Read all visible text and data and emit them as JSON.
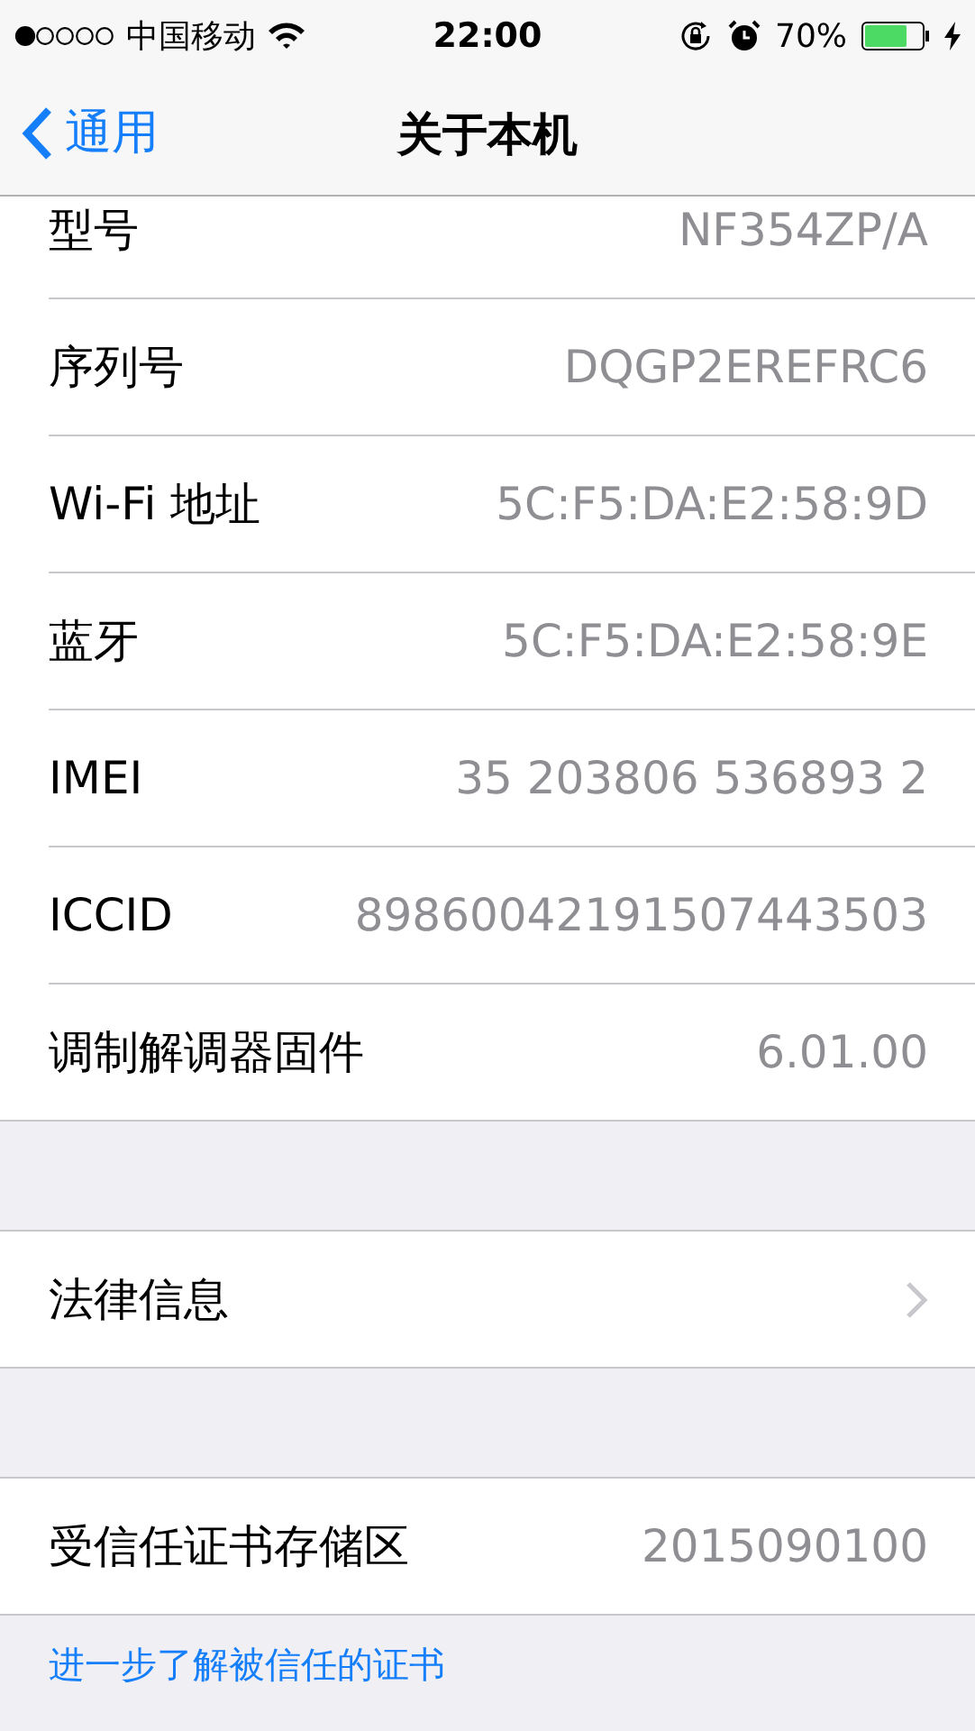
{
  "status_bar": {
    "carrier": "中国移动",
    "time": "22:00",
    "battery": "70%"
  },
  "nav_bar": {
    "back": "通用",
    "title": "关于本机"
  },
  "sections": [
    {
      "rows": [
        {
          "kind": "value",
          "label": "型号",
          "value": "NF354ZP/A"
        },
        {
          "kind": "value",
          "label": "序列号",
          "value": "DQGP2EREFRC6"
        },
        {
          "kind": "value",
          "label": "Wi-Fi 地址",
          "value": "5C:F5:DA:E2:58:9D"
        },
        {
          "kind": "value",
          "label": "蓝牙",
          "value": "5C:F5:DA:E2:58:9E"
        },
        {
          "kind": "value",
          "label": "IMEI",
          "value": "35 203806 536893 2"
        },
        {
          "kind": "value",
          "label": "ICCID",
          "value": "89860042191507443503"
        },
        {
          "kind": "value",
          "label": "调制解调器固件",
          "value": "6.01.00"
        }
      ]
    },
    {
      "rows": [
        {
          "kind": "link",
          "label": "法律信息"
        }
      ]
    },
    {
      "rows": [
        {
          "kind": "value",
          "label": "受信任证书存储区",
          "value": "2015090100"
        }
      ],
      "footer_link": "进一步了解被信任的证书"
    }
  ]
}
